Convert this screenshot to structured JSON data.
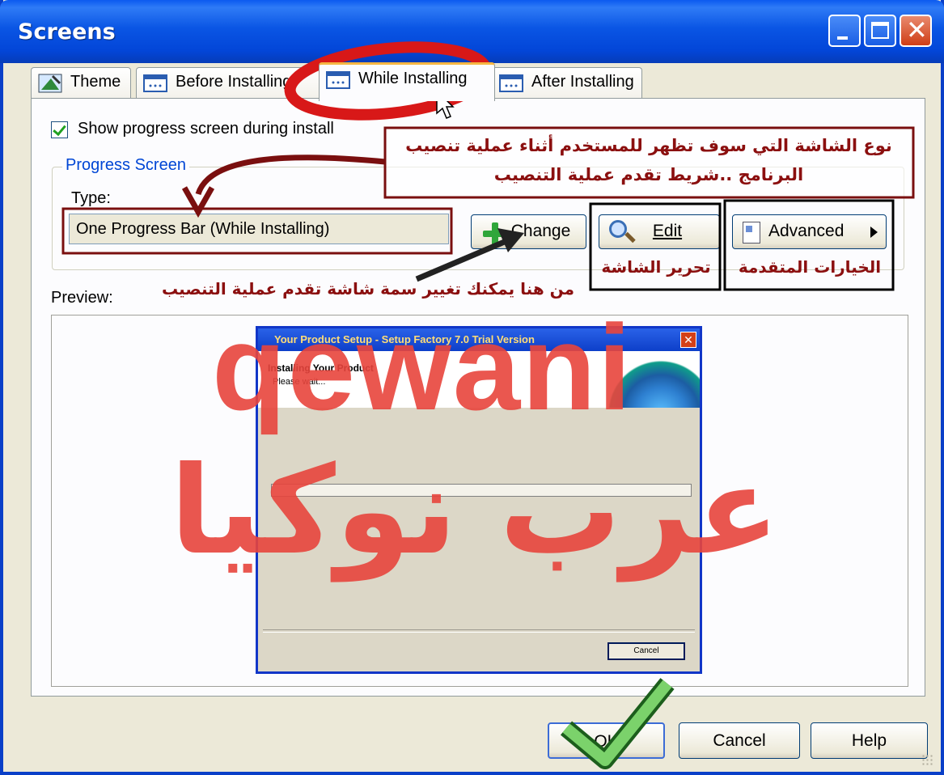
{
  "window": {
    "title": "Screens"
  },
  "tabs": [
    {
      "label": "Theme",
      "icon": "theme-icon",
      "active": false
    },
    {
      "label": "Before Installing",
      "icon": "screen-icon",
      "active": false
    },
    {
      "label": "While Installing",
      "icon": "screen-icon",
      "active": true
    },
    {
      "label": "After Installing",
      "icon": "screen-icon",
      "active": false
    }
  ],
  "panel": {
    "show_progress_label": "Show progress screen during install",
    "show_progress_checked": true,
    "group_label": "Progress Screen",
    "type_label": "Type:",
    "type_value": "One Progress Bar (While Installing)",
    "change_label": "Change",
    "edit_label": "Edit",
    "advanced_label": "Advanced",
    "preview_label": "Preview:"
  },
  "preview": {
    "title": "Your Product Setup - Setup Factory 7.0 Trial Version",
    "heading": "Installing Your Product",
    "subheading": "Please wait...",
    "cancel_label": "Cancel",
    "progress": 0
  },
  "footer": {
    "ok_label": "OK",
    "cancel_label": "Cancel",
    "help_label": "Help"
  },
  "annotations": {
    "screen_type_line1": "نوع الشاشة التي سوف تظهر للمستخدم أثناء عملية تنصيب",
    "screen_type_line2": "البرنامج ..شريط تقدم عملية التنصيب",
    "edit_screen": "تحرير الشاشة",
    "advanced_options": "الخيارات المتقدمة",
    "change_theme": "من هنا يمكنك تغيير سمة شاشة تقدم عملية التنصيب"
  },
  "watermark": {
    "latin": "qewani",
    "arabic": "عرب نوكيا"
  },
  "colors": {
    "annotation": "#8b0f0f",
    "watermark": "#e8453d",
    "titlebar": "#0a55e4",
    "check": "#2fa63a"
  }
}
